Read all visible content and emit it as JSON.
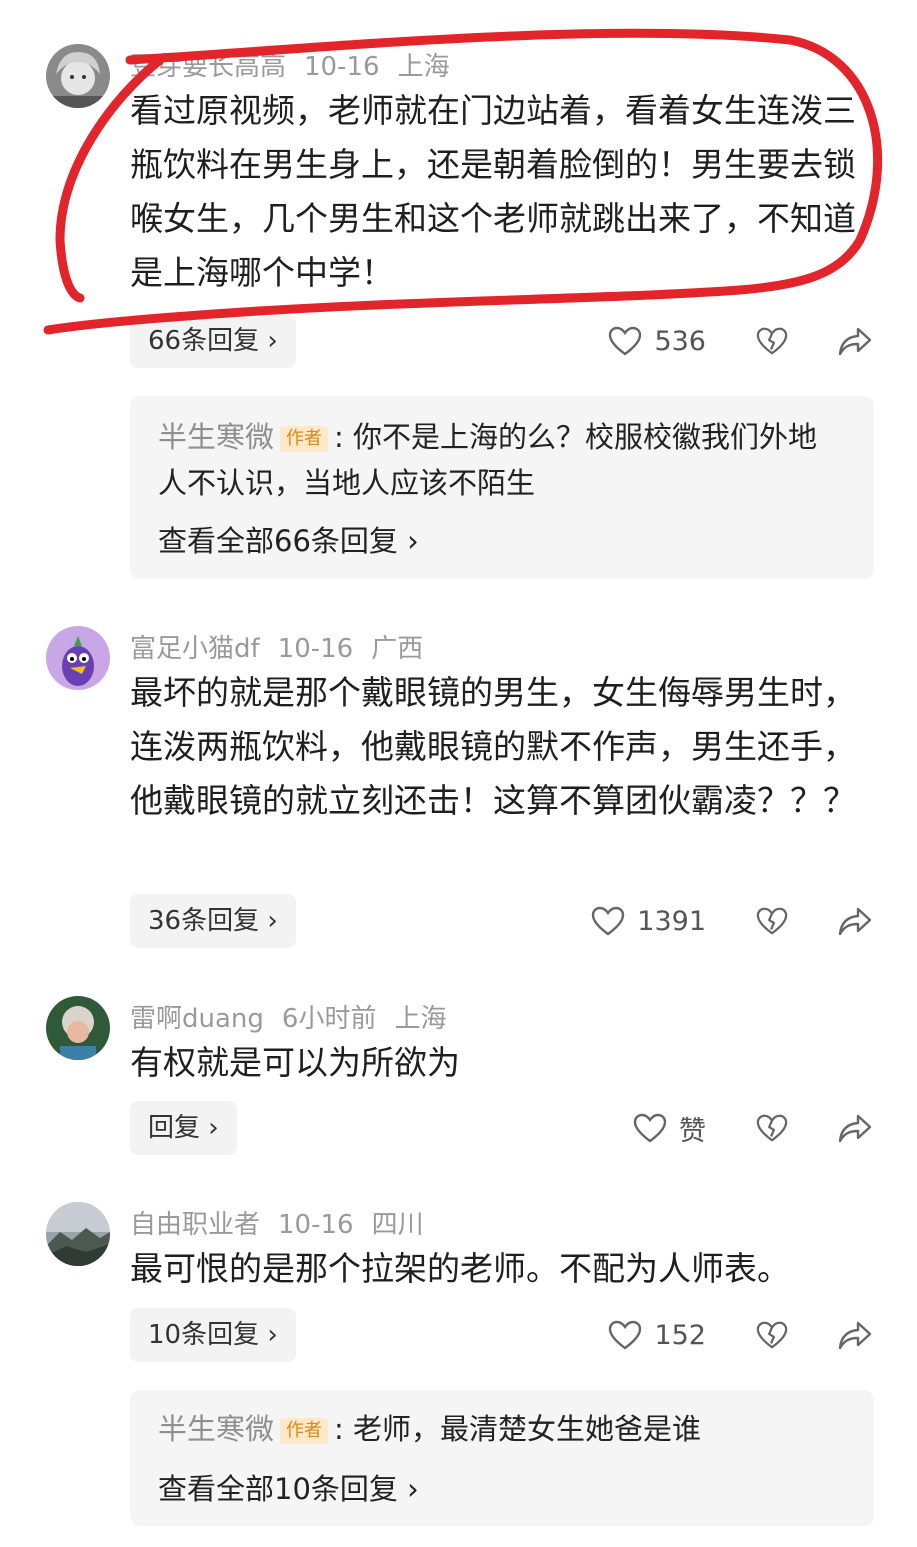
{
  "colors": {
    "annotation": "#e2242b",
    "author_badge_bg": "#fde8c8",
    "author_badge_fg": "#d98a1a",
    "meta": "#9a9a9a"
  },
  "comments": [
    {
      "username": "豆芽要长高高",
      "time": "10-16",
      "location": "上海",
      "text": "看过原视频，老师就在门边站着，看着女生连泼三瓶饮料在男生身上，还是朝着脸倒的！男生要去锁喉女生，几个男生和这个老师就跳出来了，不知道是上海哪个中学！",
      "reply_label": "66条回复 ›",
      "likes": "536",
      "sub_reply": {
        "name": "半生寒微",
        "badge": "作者",
        "text": ": 你不是上海的么？校服校徽我们外地人不认识，当地人应该不陌生",
        "view_all": "查看全部66条回复 ›"
      }
    },
    {
      "username": "富足小猫df",
      "time": "10-16",
      "location": "广西",
      "text": "最坏的就是那个戴眼镜的男生，女生侮辱男生时，连泼两瓶饮料，他戴眼镜的默不作声，男生还手，他戴眼镜的就立刻还击！这算不算团伙霸凌？？？",
      "reply_label": "36条回复 ›",
      "likes": "1391"
    },
    {
      "username": "雷啊duang",
      "time": "6小时前",
      "location": "上海",
      "text": "有权就是可以为所欲为",
      "reply_label": "回复 ›",
      "likes": "赞"
    },
    {
      "username": "自由职业者",
      "time": "10-16",
      "location": "四川",
      "text": "最可恨的是那个拉架的老师。不配为人师表。",
      "reply_label": "10条回复 ›",
      "likes": "152",
      "sub_reply": {
        "name": "半生寒微",
        "badge": "作者",
        "text": ": 老师，最清楚女生她爸是谁",
        "view_all": "查看全部10条回复 ›"
      }
    }
  ]
}
